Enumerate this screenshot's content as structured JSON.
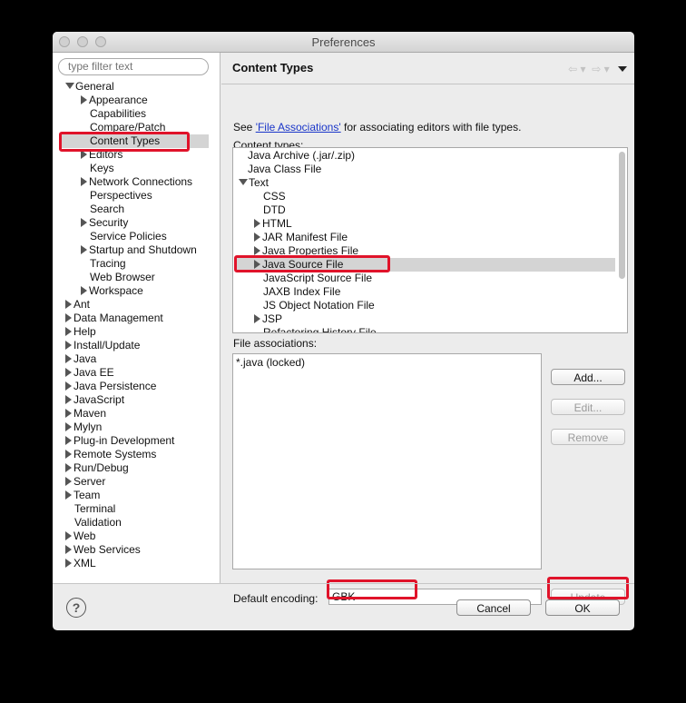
{
  "window": {
    "title": "Preferences"
  },
  "sidebar": {
    "filter_placeholder": "type filter text",
    "items": [
      {
        "label": "General",
        "indent": 0,
        "expander": "open"
      },
      {
        "label": "Appearance",
        "indent": 1,
        "expander": "closed"
      },
      {
        "label": "Capabilities",
        "indent": 1,
        "expander": "none"
      },
      {
        "label": "Compare/Patch",
        "indent": 1,
        "expander": "none"
      },
      {
        "label": "Content Types",
        "indent": 1,
        "expander": "none",
        "selected": true
      },
      {
        "label": "Editors",
        "indent": 1,
        "expander": "closed"
      },
      {
        "label": "Keys",
        "indent": 1,
        "expander": "none"
      },
      {
        "label": "Network Connections",
        "indent": 1,
        "expander": "closed"
      },
      {
        "label": "Perspectives",
        "indent": 1,
        "expander": "none"
      },
      {
        "label": "Search",
        "indent": 1,
        "expander": "none"
      },
      {
        "label": "Security",
        "indent": 1,
        "expander": "closed"
      },
      {
        "label": "Service Policies",
        "indent": 1,
        "expander": "none"
      },
      {
        "label": "Startup and Shutdown",
        "indent": 1,
        "expander": "closed"
      },
      {
        "label": "Tracing",
        "indent": 1,
        "expander": "none"
      },
      {
        "label": "Web Browser",
        "indent": 1,
        "expander": "none"
      },
      {
        "label": "Workspace",
        "indent": 1,
        "expander": "closed"
      },
      {
        "label": "Ant",
        "indent": 0,
        "expander": "closed"
      },
      {
        "label": "Data Management",
        "indent": 0,
        "expander": "closed"
      },
      {
        "label": "Help",
        "indent": 0,
        "expander": "closed"
      },
      {
        "label": "Install/Update",
        "indent": 0,
        "expander": "closed"
      },
      {
        "label": "Java",
        "indent": 0,
        "expander": "closed"
      },
      {
        "label": "Java EE",
        "indent": 0,
        "expander": "closed"
      },
      {
        "label": "Java Persistence",
        "indent": 0,
        "expander": "closed"
      },
      {
        "label": "JavaScript",
        "indent": 0,
        "expander": "closed"
      },
      {
        "label": "Maven",
        "indent": 0,
        "expander": "closed"
      },
      {
        "label": "Mylyn",
        "indent": 0,
        "expander": "closed"
      },
      {
        "label": "Plug-in Development",
        "indent": 0,
        "expander": "closed"
      },
      {
        "label": "Remote Systems",
        "indent": 0,
        "expander": "closed"
      },
      {
        "label": "Run/Debug",
        "indent": 0,
        "expander": "closed"
      },
      {
        "label": "Server",
        "indent": 0,
        "expander": "closed"
      },
      {
        "label": "Team",
        "indent": 0,
        "expander": "closed"
      },
      {
        "label": "Terminal",
        "indent": 0,
        "expander": "none"
      },
      {
        "label": "Validation",
        "indent": 0,
        "expander": "none"
      },
      {
        "label": "Web",
        "indent": 0,
        "expander": "closed"
      },
      {
        "label": "Web Services",
        "indent": 0,
        "expander": "closed"
      },
      {
        "label": "XML",
        "indent": 0,
        "expander": "closed"
      }
    ]
  },
  "main": {
    "title": "Content Types",
    "see_prefix": "See ",
    "see_link": "'File Associations'",
    "see_suffix": " for associating editors with file types.",
    "content_types_label": "Content types:",
    "content_types": [
      {
        "label": "Java Archive (.jar/.zip)",
        "indent": 0,
        "expander": "none"
      },
      {
        "label": "Java Class File",
        "indent": 0,
        "expander": "none"
      },
      {
        "label": "Text",
        "indent": 0,
        "expander": "open"
      },
      {
        "label": "CSS",
        "indent": 1,
        "expander": "none"
      },
      {
        "label": "DTD",
        "indent": 1,
        "expander": "none"
      },
      {
        "label": "HTML",
        "indent": 1,
        "expander": "closed"
      },
      {
        "label": "JAR Manifest File",
        "indent": 1,
        "expander": "closed"
      },
      {
        "label": "Java Properties File",
        "indent": 1,
        "expander": "closed"
      },
      {
        "label": "Java Source File",
        "indent": 1,
        "expander": "closed",
        "selected": true
      },
      {
        "label": "JavaScript Source File",
        "indent": 1,
        "expander": "none"
      },
      {
        "label": "JAXB Index File",
        "indent": 1,
        "expander": "none"
      },
      {
        "label": "JS Object Notation File",
        "indent": 1,
        "expander": "none"
      },
      {
        "label": "JSP",
        "indent": 1,
        "expander": "closed"
      },
      {
        "label": "Refactoring History File",
        "indent": 1,
        "expander": "none"
      }
    ],
    "file_assoc_label": "File associations:",
    "file_associations": [
      "*.java (locked)"
    ],
    "buttons": {
      "add": "Add...",
      "edit": "Edit...",
      "remove": "Remove",
      "update": "Update"
    },
    "default_encoding_label": "Default encoding:",
    "default_encoding_value": "GBK"
  },
  "footer": {
    "cancel": "Cancel",
    "ok": "OK",
    "help_glyph": "?"
  },
  "colors": {
    "highlight": "#e0132a",
    "link": "#1a36c9",
    "selection": "#d4d4d4"
  }
}
